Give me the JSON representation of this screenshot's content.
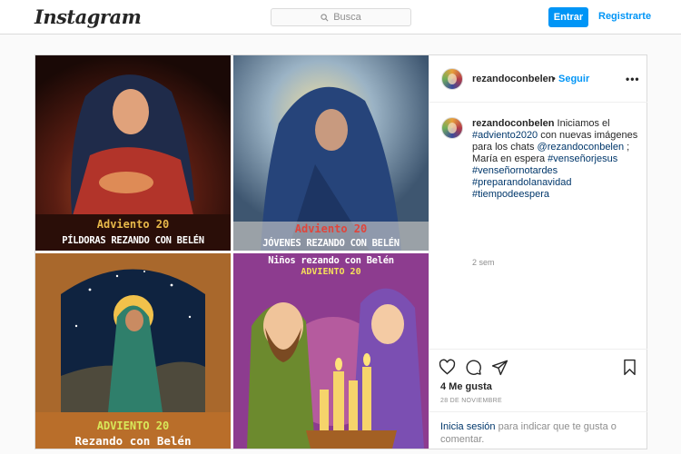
{
  "header": {
    "logo": "Instagram",
    "search_placeholder": "Busca",
    "login_label": "Entrar",
    "register_label": "Registrarte"
  },
  "post": {
    "username": "rezandoconbelen",
    "separator": "•",
    "follow_label": "Seguir",
    "more_label": "•••",
    "images": [
      {
        "line1": "Adviento 20",
        "line2": "PÍLDORAS REZANDO CON BELÉN"
      },
      {
        "line1": "Adviento 20",
        "line2": "JÓVENES REZANDO CON BELÉN"
      },
      {
        "line1": "ADVIENTO 20",
        "line2": "Rezando con Belén"
      },
      {
        "line1": "Niños rezando con Belén",
        "line2": "ADVIENTO 20"
      }
    ],
    "caption": {
      "username": "rezandoconbelen",
      "text1": " Iniciamos el ",
      "tag1": "#adviento2020",
      "text2": " con nuevas imágenes para los chats ",
      "mention": "@rezandoconbelen",
      "text3": " ; María en espera ",
      "tag2": "#venseñorjesus",
      "tag3": "#venseñornotardes",
      "tag4": "#preparandolanavidad",
      "tag5": "#tiempodeespera",
      "time_ago": "2 sem"
    },
    "likes": "4 Me gusta",
    "date": "28 DE NOVIEMBRE",
    "login_prompt": {
      "link": "Inicia sesión",
      "text": " para indicar que te gusta o comentar."
    }
  },
  "colors": {
    "accent": "#0095f6",
    "hashtag": "#00376b",
    "muted": "#8e8e8e",
    "caption_gold": "#e8b94a",
    "caption_red": "#e0453b",
    "caption_lime": "#d8e85a"
  }
}
